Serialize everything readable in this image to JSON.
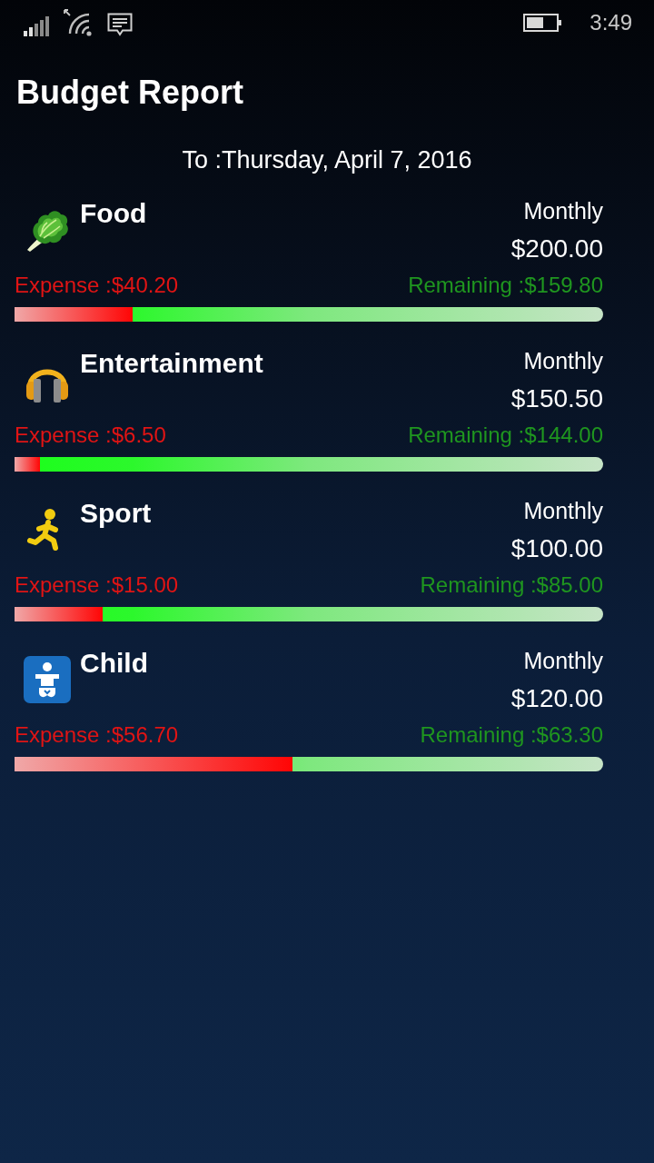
{
  "status_bar": {
    "time": "3:49"
  },
  "title": "Budget Report",
  "date": "To :Thursday, April 7, 2016",
  "categories": [
    {
      "kind": "food",
      "name": "Food",
      "period": "Monthly",
      "amount": "$200.00",
      "expense": "Expense :$40.20",
      "remaining": "Remaining :$159.80",
      "level": 0.201
    },
    {
      "kind": "entertainment",
      "name": "Entertainment",
      "period": "Monthly",
      "amount": "$150.50",
      "expense": "Expense :$6.50",
      "remaining": "Remaining :$144.00",
      "level": 0.043
    },
    {
      "kind": "sport",
      "name": "Sport",
      "period": "Monthly",
      "amount": "$100.00",
      "expense": "Expense :$15.00",
      "remaining": "Remaining :$85.00",
      "level": 0.15
    },
    {
      "kind": "child",
      "name": "Child",
      "period": "Monthly",
      "amount": "$120.00",
      "expense": "Expense :$56.70",
      "remaining": "Remaining :$63.30",
      "level": 0.4725
    }
  ]
}
